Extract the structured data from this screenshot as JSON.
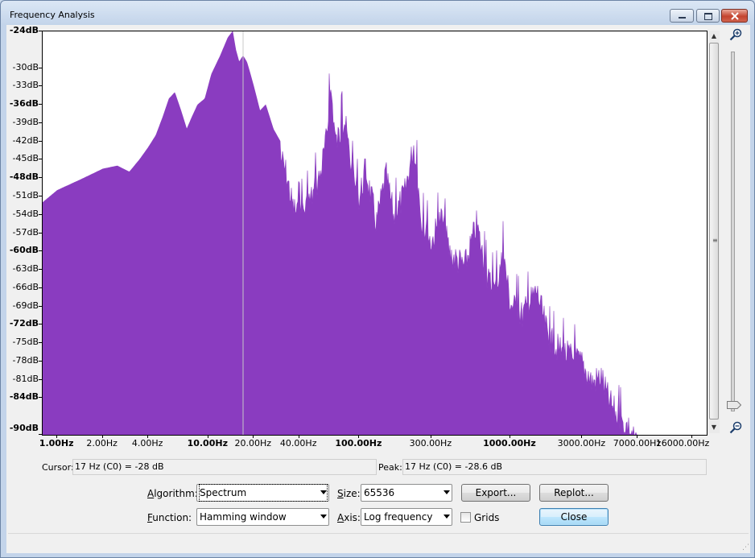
{
  "window": {
    "title": "Frequency Analysis"
  },
  "chart_data": {
    "type": "area",
    "x_scale": "log",
    "color": "#8a3cc0",
    "y_ticks": [
      "-24dB",
      "-30dB",
      "-33dB",
      "-36dB",
      "-39dB",
      "-42dB",
      "-45dB",
      "-48dB",
      "-51dB",
      "-54dB",
      "-57dB",
      "-60dB",
      "-63dB",
      "-66dB",
      "-69dB",
      "-72dB",
      "-75dB",
      "-78dB",
      "-81dB",
      "-84dB",
      "-90dB"
    ],
    "y_bold": [
      "-24dB",
      "-36dB",
      "-48dB",
      "-60dB",
      "-72dB",
      "-84dB",
      "-90dB"
    ],
    "x_ticks": [
      "1.00Hz",
      "2.00Hz",
      "4.00Hz",
      "10.00Hz",
      "20.00Hz",
      "40.00Hz",
      "100.00Hz",
      "300.00Hz",
      "1000.00Hz",
      "3000.00Hz",
      "7000.00Hz",
      "16000.00Hz"
    ],
    "x_bold": [
      "1.00Hz",
      "10.00Hz",
      "100.00Hz",
      "1000.00Hz"
    ],
    "ylim": [
      -90,
      -24
    ],
    "xlim": [
      0.8,
      20000
    ],
    "cursor_hz": 17,
    "envelope": [
      [
        0.8,
        -52
      ],
      [
        1.0,
        -50
      ],
      [
        1.5,
        -48
      ],
      [
        2.0,
        -46.5
      ],
      [
        2.5,
        -46
      ],
      [
        3.0,
        -47
      ],
      [
        3.5,
        -45
      ],
      [
        4.0,
        -43
      ],
      [
        4.5,
        -41
      ],
      [
        5.0,
        -38
      ],
      [
        5.5,
        -35
      ],
      [
        6.0,
        -34
      ],
      [
        6.6,
        -37
      ],
      [
        7.2,
        -40
      ],
      [
        7.8,
        -38
      ],
      [
        8.5,
        -36
      ],
      [
        9.5,
        -35
      ],
      [
        10.5,
        -31
      ],
      [
        12,
        -28
      ],
      [
        13.5,
        -25
      ],
      [
        14.5,
        -24
      ],
      [
        15.2,
        -27
      ],
      [
        16,
        -29
      ],
      [
        17,
        -28
      ],
      [
        18,
        -29
      ],
      [
        19,
        -31
      ],
      [
        20,
        -33
      ],
      [
        22,
        -37
      ],
      [
        24,
        -36
      ],
      [
        27,
        -40
      ],
      [
        30,
        -42
      ],
      [
        33,
        -45
      ],
      [
        36,
        -50
      ],
      [
        40,
        -52
      ],
      [
        45,
        -50
      ],
      [
        50,
        -48
      ],
      [
        55,
        -45
      ],
      [
        60,
        -40
      ],
      [
        65,
        -31
      ],
      [
        70,
        -40
      ],
      [
        80,
        -36
      ],
      [
        90,
        -45
      ],
      [
        100,
        -49
      ],
      [
        110,
        -44
      ],
      [
        130,
        -53
      ],
      [
        150,
        -45
      ],
      [
        170,
        -52
      ],
      [
        200,
        -48
      ],
      [
        230,
        -40
      ],
      [
        260,
        -53
      ],
      [
        300,
        -56
      ],
      [
        350,
        -52
      ],
      [
        400,
        -58
      ],
      [
        500,
        -60
      ],
      [
        600,
        -53
      ],
      [
        700,
        -62
      ],
      [
        800,
        -64
      ],
      [
        900,
        -58
      ],
      [
        1000,
        -66
      ],
      [
        1200,
        -68
      ],
      [
        1500,
        -64
      ],
      [
        1800,
        -72
      ],
      [
        2200,
        -74
      ],
      [
        2600,
        -75
      ],
      [
        3000,
        -76
      ],
      [
        3500,
        -79
      ],
      [
        4000,
        -78
      ],
      [
        4500,
        -82
      ],
      [
        5000,
        -84
      ],
      [
        5500,
        -86
      ],
      [
        6000,
        -86
      ],
      [
        6500,
        -88
      ],
      [
        7000,
        -90
      ]
    ]
  },
  "status": {
    "cursor_label": "Cursor:",
    "cursor_value": "17 Hz (C0) = -28 dB",
    "peak_label": "Peak:",
    "peak_value": "17 Hz (C0) = -28.6 dB"
  },
  "controls": {
    "algorithm_label": "Algorithm:",
    "algorithm_value": "Spectrum",
    "function_label": "Function:",
    "function_value": "Hamming window",
    "size_label": "Size:",
    "size_value": "65536",
    "axis_label": "Axis:",
    "axis_value": "Log frequency",
    "grids_label": "Grids",
    "export_label": "Export...",
    "replot_label": "Replot...",
    "close_label": "Close"
  }
}
